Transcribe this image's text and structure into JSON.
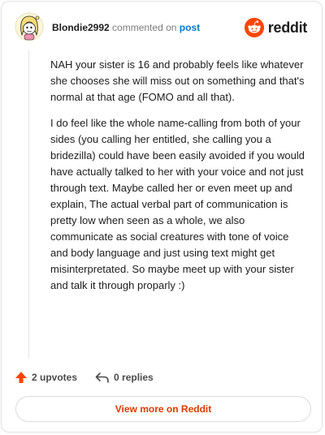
{
  "header": {
    "username": "Blondie2992",
    "action_text": "commented on",
    "post_link": "post",
    "brand": "reddit"
  },
  "comment": {
    "paragraphs": [
      "NAH your sister is 16 and probably feels like whatever she chooses she will miss out on something and that's normal at that age (FOMO and all that).",
      "I do feel like the whole name-calling from both of your sides (you calling her entitled, she calling you a bridezilla) could have been easily avoided if you would have actually talked to her with your voice and not just through text. Maybe called her or even meet up and explain, The actual verbal part of communication is pretty low when seen as a whole, we also communicate as social creatures with tone of voice and body language and just using text might get misinterpretated. So maybe meet up with your sister and talk it through proparly :)"
    ]
  },
  "actions": {
    "upvotes": "2 upvotes",
    "replies": "0 replies"
  },
  "footer": {
    "view_more": "View more on Reddit"
  },
  "icons": {
    "upvote": "upvote-arrow-icon",
    "reply": "reply-arrow-icon",
    "brand_logo": "reddit-snoo-icon",
    "avatar": "snoo-avatar-icon"
  },
  "colors": {
    "brand_orange": "#ff4500",
    "link_blue": "#0079d3",
    "button_text": "#d93a00"
  }
}
